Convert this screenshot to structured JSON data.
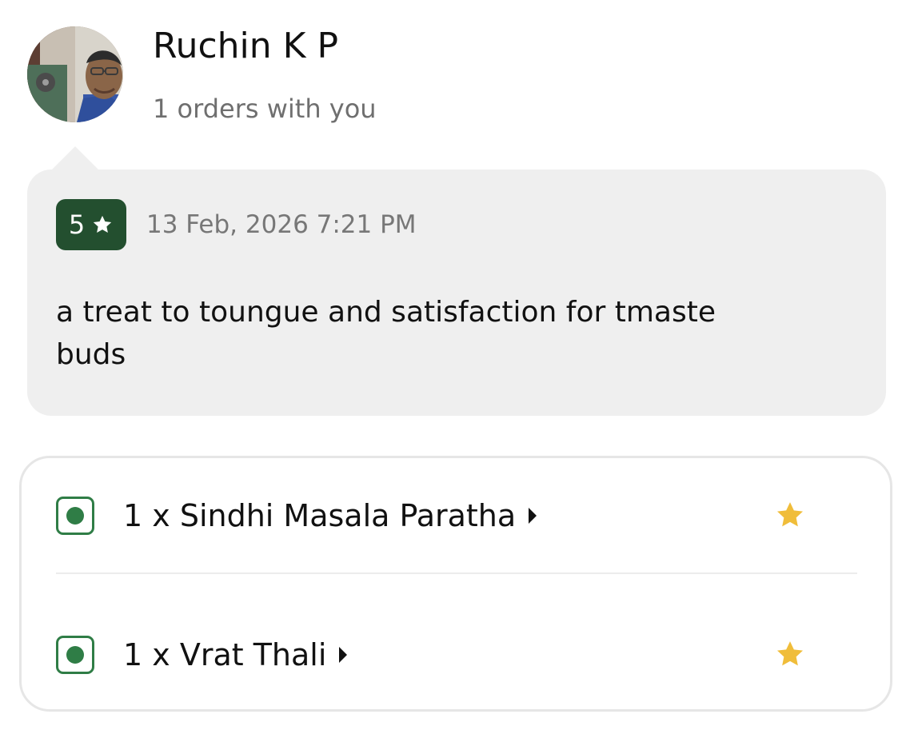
{
  "reviewer": {
    "name": "Ruchin K P",
    "order_count_text": "1 orders with you",
    "avatar_icon": "user-photo"
  },
  "review": {
    "rating": "5",
    "rating_icon": "star-icon",
    "date": "13 Feb, 2026 7:21 PM",
    "text": "a treat to toungue and satisfaction for tmaste buds"
  },
  "items": [
    {
      "label": "1 x Sindhi Masala Paratha",
      "type_icon": "veg-icon",
      "rating_icon": "star-icon"
    },
    {
      "label": "1 x Vrat Thali",
      "type_icon": "veg-icon",
      "rating_icon": "star-icon"
    }
  ],
  "colors": {
    "rating_badge": "#234f2f",
    "veg_green": "#2f7d46",
    "star_yellow": "#f0bd3a",
    "bubble_bg": "#efefef"
  }
}
